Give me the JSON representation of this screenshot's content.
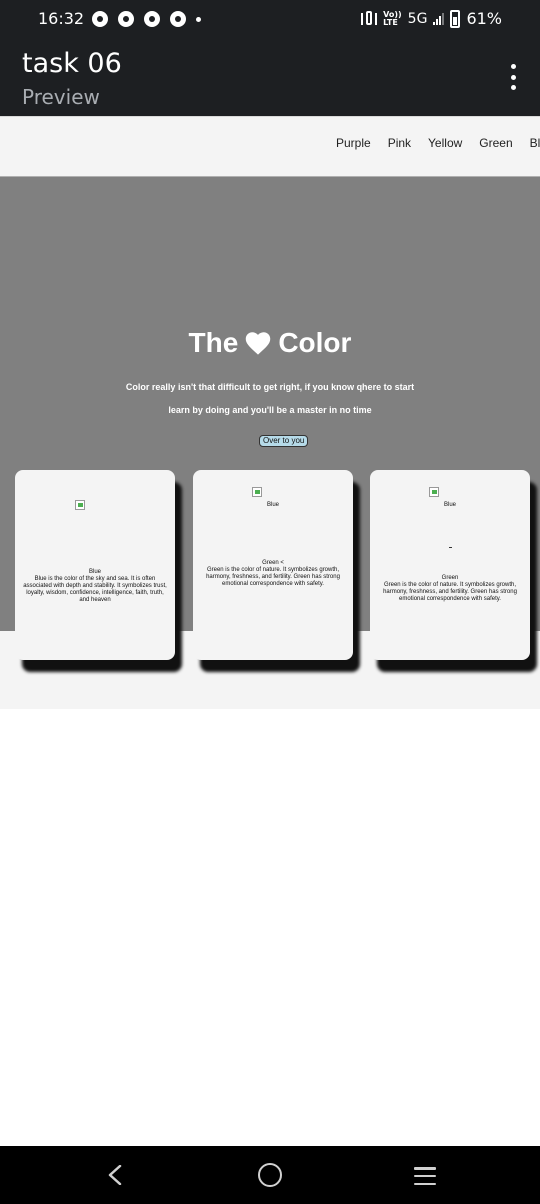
{
  "status_bar": {
    "time": "16:32",
    "network": "5G",
    "lte_top": "Vo))",
    "lte_bottom": "LTE",
    "battery": "61%"
  },
  "app_bar": {
    "title": "task 06",
    "subtitle": "Preview"
  },
  "nav": {
    "links": [
      "Purple",
      "Pink",
      "Yellow",
      "Green",
      "Bl"
    ]
  },
  "hero": {
    "title_left": "The",
    "title_right": "Color",
    "line1": "Color really isn't that difficult to get right, if you know qhere to start",
    "line2": "learn by doing and you'll be a master in no time",
    "button": "Over to you"
  },
  "cards": [
    {
      "heading": "Blue",
      "desc": "Blue is the color of the sky and sea. It is often associated with depth and stability. It symbolizes trust, loyalty, wisdom, confidence, intelligence, faith, truth, and heaven"
    },
    {
      "top_label": "Blue",
      "heading": "Green <",
      "desc": "Green is the color of nature. It symbolizes growth, harmony, freshness, and fertility. Green has strong emotional correspondence with safety."
    },
    {
      "top_label": "Blue",
      "heading": "Green",
      "desc": "Green is the color of nature. It symbolizes growth, harmony, freshness, and fertility. Green has strong emotional correspondence with safety."
    }
  ],
  "colors": {
    "app_bar": "#1d1f22",
    "hero": "#808080",
    "button": "#b6dbe9"
  }
}
